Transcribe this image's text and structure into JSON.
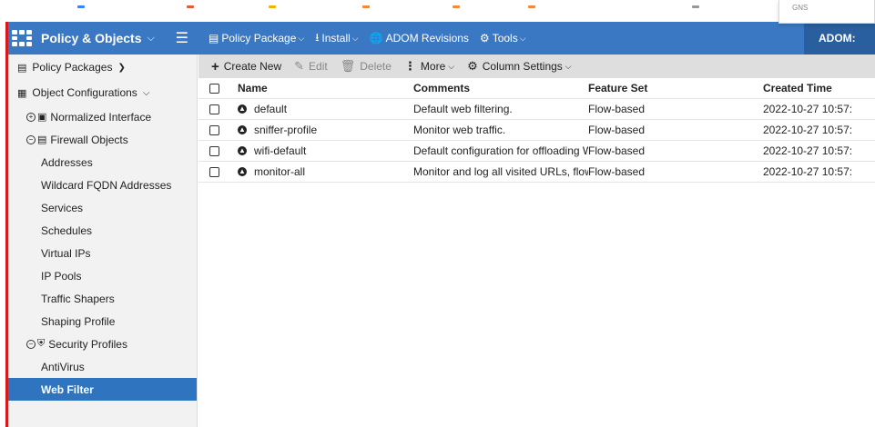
{
  "browser_popup": {
    "text": "GNS"
  },
  "app": {
    "title": "Policy & Objects",
    "menu_icon": "grid-icon",
    "hamburger_icon": "hamburger-icon"
  },
  "topnav": {
    "items": [
      {
        "label": "Policy Package",
        "icon": "policy-package-icon",
        "has_dropdown": true
      },
      {
        "label": "Install",
        "icon": "install-icon",
        "has_dropdown": true
      },
      {
        "label": "ADOM Revisions",
        "icon": "globe-icon",
        "has_dropdown": false
      },
      {
        "label": "Tools",
        "icon": "gear-icon",
        "has_dropdown": true
      }
    ],
    "adom_label": "ADOM: "
  },
  "sidebar": {
    "policy_packages": "Policy Packages",
    "object_configurations": "Object Configurations",
    "normalized_interface": "Normalized Interface",
    "firewall_objects": "Firewall Objects",
    "firewall_items": [
      "Addresses",
      "Wildcard FQDN Addresses",
      "Services",
      "Schedules",
      "Virtual IPs",
      "IP Pools",
      "Traffic Shapers",
      "Shaping Profile"
    ],
    "security_profiles": "Security Profiles",
    "security_items": [
      "AntiVirus",
      "Web Filter"
    ],
    "active_item": "Web Filter"
  },
  "toolbar": {
    "create_new": "Create New",
    "edit": "Edit",
    "delete": "Delete",
    "more": "More",
    "column_settings": "Column Settings"
  },
  "table": {
    "columns": [
      "Name",
      "Comments",
      "Feature Set",
      "Created Time"
    ],
    "rows": [
      {
        "name": "default",
        "comments": "Default web filtering.",
        "feature_set": "Flow-based",
        "created": "2022-10-27 10:57:"
      },
      {
        "name": "sniffer-profile",
        "comments": "Monitor web traffic.",
        "feature_set": "Flow-based",
        "created": "2022-10-27 10:57:"
      },
      {
        "name": "wifi-default",
        "comments": "Default configuration for offloading WiFi traffic.",
        "feature_set": "Flow-based",
        "created": "2022-10-27 10:57:"
      },
      {
        "name": "monitor-all",
        "comments": "Monitor and log all visited URLs, flow-based.",
        "feature_set": "Flow-based",
        "created": "2022-10-27 10:57:"
      }
    ]
  },
  "colors": {
    "header_blue": "#3a78c3",
    "adom_blue": "#2a5f9f",
    "active_blue": "#2e74bf",
    "toolbar_gray": "#dedede",
    "sidebar_gray": "#f2f2f2",
    "left_red": "#d41a1a"
  }
}
